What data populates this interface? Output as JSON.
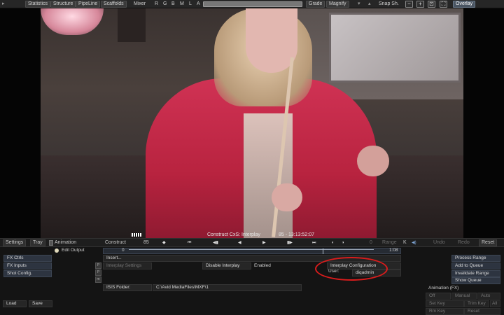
{
  "toolbar": {
    "statistics": "Statistics",
    "structure": "Structure",
    "pipeline": "PipeLine",
    "scaffolds": "Scaffolds",
    "mixer": "Mixer",
    "channels": [
      "R",
      "G",
      "B",
      "M",
      "L",
      "A"
    ],
    "grade": "Grade",
    "magnify": "Magnify",
    "snapshot": "Snap Sh.",
    "overlay": "Overlay"
  },
  "viewer": {
    "caption_left": "Construct CxS: Interplay",
    "caption_right": "85 - 13:13:52:07"
  },
  "timeline": {
    "settings": "Settings",
    "tray": "Tray",
    "animation": "Animation",
    "construct": "Construct",
    "frame_number": "85",
    "value_zero": "0",
    "range": "Range",
    "k": "K",
    "undo": "Undo",
    "redo": "Redo",
    "reset": "Reset"
  },
  "panel": {
    "fx_ctrls": "FX Ctrls",
    "fx_inputs": "FX Inputs",
    "shot_config": "Shot Config.",
    "edit_output": "Edit Output",
    "range_start": "0",
    "range_end": "1:08",
    "insert": "Insert...",
    "p_chips": [
      "P",
      "P",
      "m"
    ],
    "interplay_settings": "Interplay Settings",
    "disable_interplay": "Disable Interplay",
    "enabled": "Enabled",
    "interplay_configuration": "Interplay Configuration",
    "user_label": "User:",
    "user_value": "diqadmin",
    "isis_folder_label": "ISIS Folder:",
    "isis_folder_value": "C:\\Avid MediaFiles\\MXF\\1",
    "process_range": "Process Range",
    "add_to_queue": "Add to Queue",
    "invalidate_range": "Invalidate Range",
    "show_queue": "Show Queue",
    "animation_fx": "Animation (FX)",
    "off": "Off",
    "manual": "Manual",
    "auto": "Auto",
    "set_key": "Set Key",
    "trim_key": "Trim Key",
    "all": "All",
    "rm_key": "Rm Key",
    "reset": "Reset",
    "load": "Load",
    "save": "Save"
  },
  "colors": {
    "annotation_ellipse": "#d91c1c",
    "panel_button": "#2d3440"
  }
}
